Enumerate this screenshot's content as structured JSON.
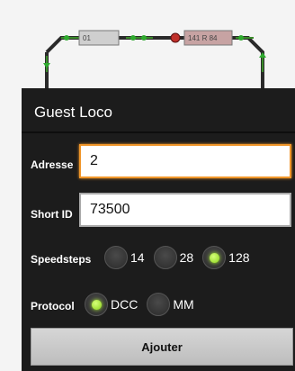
{
  "background": {
    "block_labels": [
      "01",
      "141 R 84"
    ]
  },
  "dialog": {
    "title": "Guest Loco",
    "address": {
      "label": "Adresse",
      "value": "2"
    },
    "short_id": {
      "label": "Short ID",
      "value": "73500"
    },
    "speedsteps": {
      "label": "Speedsteps",
      "options": [
        "14",
        "28",
        "128"
      ],
      "selected": "128"
    },
    "protocol": {
      "label": "Protocol",
      "options": [
        "DCC",
        "MM"
      ],
      "selected": "DCC"
    },
    "add_button_label": "Ajouter"
  },
  "colors": {
    "accent_focus": "#f0962a",
    "radio_on": "#a8f02a",
    "dialog_bg": "#1c1c1c"
  }
}
